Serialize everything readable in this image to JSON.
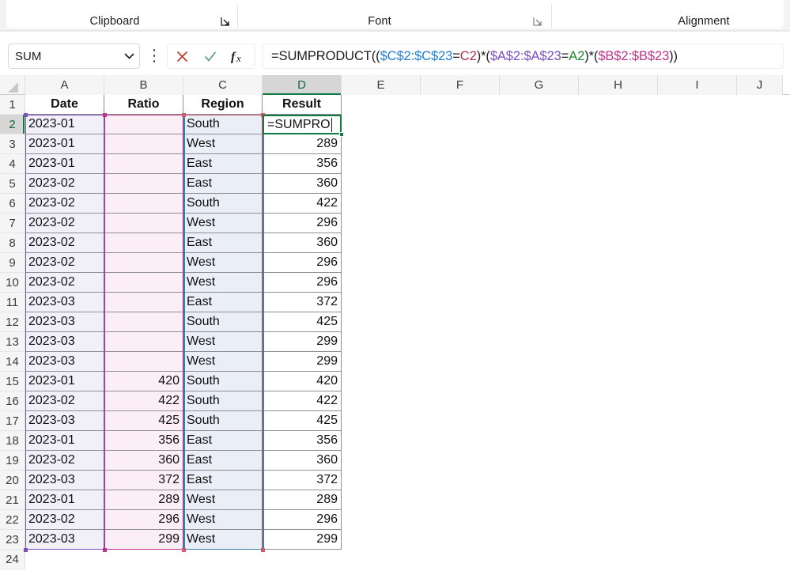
{
  "ribbon": {
    "groups": [
      {
        "label": "Clipboard",
        "has_launcher": true
      },
      {
        "label": "Font",
        "has_launcher": true
      },
      {
        "label": "Alignment",
        "has_launcher": false
      }
    ]
  },
  "formula_bar": {
    "name_box_value": "SUM",
    "name_box_icon": "chevron-down-icon",
    "more_icon": "kebab-menu-icon",
    "cancel_icon": "cancel-x-icon",
    "confirm_icon": "confirm-check-icon",
    "function_icon": "insert-function-fx-icon",
    "formula": "=SUMPRODUCT(($C$2:$C$23=C2)*($A$2:$A$23=A2)*($B$2:$B$23))",
    "formula_tokens": [
      {
        "text": "=SUMPRODUCT((",
        "color": "#1b1b1b"
      },
      {
        "text": "$C$2:$C$23",
        "color": "#1f7fd6"
      },
      {
        "text": "=",
        "color": "#1b1b1b"
      },
      {
        "text": "C2",
        "color": "#b03050"
      },
      {
        "text": ")*(",
        "color": "#1b1b1b"
      },
      {
        "text": "$A$2:$A$23",
        "color": "#7b4fc0"
      },
      {
        "text": "=",
        "color": "#1b1b1b"
      },
      {
        "text": "A2",
        "color": "#1f8b35"
      },
      {
        "text": ")*(",
        "color": "#1b1b1b"
      },
      {
        "text": "$B$2:$B$23",
        "color": "#c0338a"
      },
      {
        "text": "))",
        "color": "#1b1b1b"
      }
    ]
  },
  "sheet": {
    "columns": [
      "A",
      "B",
      "C",
      "D",
      "E",
      "F",
      "G",
      "H",
      "I",
      "J"
    ],
    "active_column": "D",
    "active_row": 2,
    "active_cell_editing_text": "=SUMPRO",
    "rows": [
      1,
      2,
      3,
      4,
      5,
      6,
      7,
      8,
      9,
      10,
      11,
      12,
      13,
      14,
      15,
      16,
      17,
      18,
      19,
      20,
      21,
      22,
      23,
      24
    ],
    "headers": [
      "Date",
      "Ratio",
      "Region",
      "Result"
    ],
    "data": [
      {
        "row": 2,
        "date": "2023-01",
        "ratio": "",
        "region": "South",
        "result": ""
      },
      {
        "row": 3,
        "date": "2023-01",
        "ratio": "",
        "region": "West",
        "result": "289"
      },
      {
        "row": 4,
        "date": "2023-01",
        "ratio": "",
        "region": "East",
        "result": "356"
      },
      {
        "row": 5,
        "date": "2023-02",
        "ratio": "",
        "region": "East",
        "result": "360"
      },
      {
        "row": 6,
        "date": "2023-02",
        "ratio": "",
        "region": "South",
        "result": "422"
      },
      {
        "row": 7,
        "date": "2023-02",
        "ratio": "",
        "region": "West",
        "result": "296"
      },
      {
        "row": 8,
        "date": "2023-02",
        "ratio": "",
        "region": "East",
        "result": "360"
      },
      {
        "row": 9,
        "date": "2023-02",
        "ratio": "",
        "region": "West",
        "result": "296"
      },
      {
        "row": 10,
        "date": "2023-02",
        "ratio": "",
        "region": "West",
        "result": "296"
      },
      {
        "row": 11,
        "date": "2023-03",
        "ratio": "",
        "region": "East",
        "result": "372"
      },
      {
        "row": 12,
        "date": "2023-03",
        "ratio": "",
        "region": "South",
        "result": "425"
      },
      {
        "row": 13,
        "date": "2023-03",
        "ratio": "",
        "region": "West",
        "result": "299"
      },
      {
        "row": 14,
        "date": "2023-03",
        "ratio": "",
        "region": "West",
        "result": "299"
      },
      {
        "row": 15,
        "date": "2023-01",
        "ratio": "420",
        "region": "South",
        "result": "420"
      },
      {
        "row": 16,
        "date": "2023-02",
        "ratio": "422",
        "region": "South",
        "result": "422"
      },
      {
        "row": 17,
        "date": "2023-03",
        "ratio": "425",
        "region": "South",
        "result": "425"
      },
      {
        "row": 18,
        "date": "2023-01",
        "ratio": "356",
        "region": "East",
        "result": "356"
      },
      {
        "row": 19,
        "date": "2023-02",
        "ratio": "360",
        "region": "East",
        "result": "360"
      },
      {
        "row": 20,
        "date": "2023-03",
        "ratio": "372",
        "region": "East",
        "result": "372"
      },
      {
        "row": 21,
        "date": "2023-01",
        "ratio": "289",
        "region": "West",
        "result": "289"
      },
      {
        "row": 22,
        "date": "2023-02",
        "ratio": "296",
        "region": "West",
        "result": "296"
      },
      {
        "row": 23,
        "date": "2023-03",
        "ratio": "299",
        "region": "West",
        "result": "299"
      }
    ]
  },
  "colors": {
    "range_a": "#7b4fc0",
    "range_b": "#c0338a",
    "range_c": "#d05a72",
    "range_b_blue": "#3d7ea6",
    "active_cell": "#107c41",
    "tint_a": "#f1f0f8",
    "tint_b": "#fbeef4",
    "tint_c": "#eaeff7"
  }
}
